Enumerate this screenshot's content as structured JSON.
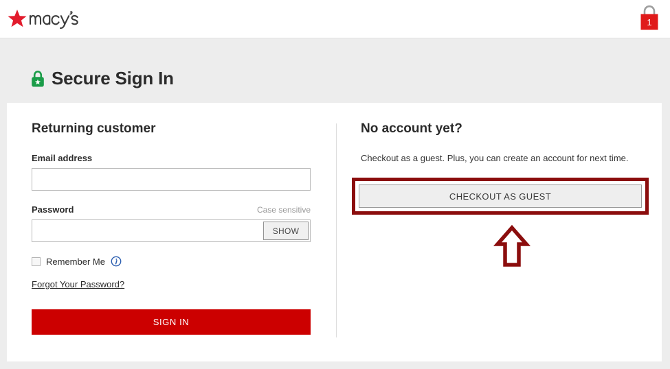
{
  "header": {
    "logo_alt": "macy's",
    "cart": {
      "icon": "shopping-bag-icon",
      "count": "1"
    }
  },
  "page": {
    "title": "Secure Sign In",
    "lock_icon": "green-padlock-icon",
    "colors": {
      "brand_red": "#cc0000",
      "annotation_red": "#8b0d0d",
      "lock_green": "#1a9c48",
      "band_gray": "#ededed",
      "link_blue": "#2a5db0"
    }
  },
  "returning_customer": {
    "heading": "Returning customer",
    "email_label": "Email address",
    "email_value": "",
    "email_placeholder": "",
    "password_label": "Password",
    "case_sensitive_note": "Case sensitive",
    "password_value": "",
    "password_placeholder": "",
    "show_button_label": "SHOW",
    "remember_me_label": "Remember Me",
    "remember_me_checked": false,
    "info_icon": "info-circle-icon",
    "forgot_password_label": "Forgot Your Password?",
    "sign_in_label": "SIGN IN"
  },
  "guest_checkout": {
    "heading": "No account yet?",
    "description": "Checkout as a guest. Plus, you can create an account for next time.",
    "button_label": "CHECKOUT AS GUEST",
    "annotation": {
      "highlight_shape": "rectangle",
      "pointer_icon": "up-arrow-icon"
    }
  }
}
